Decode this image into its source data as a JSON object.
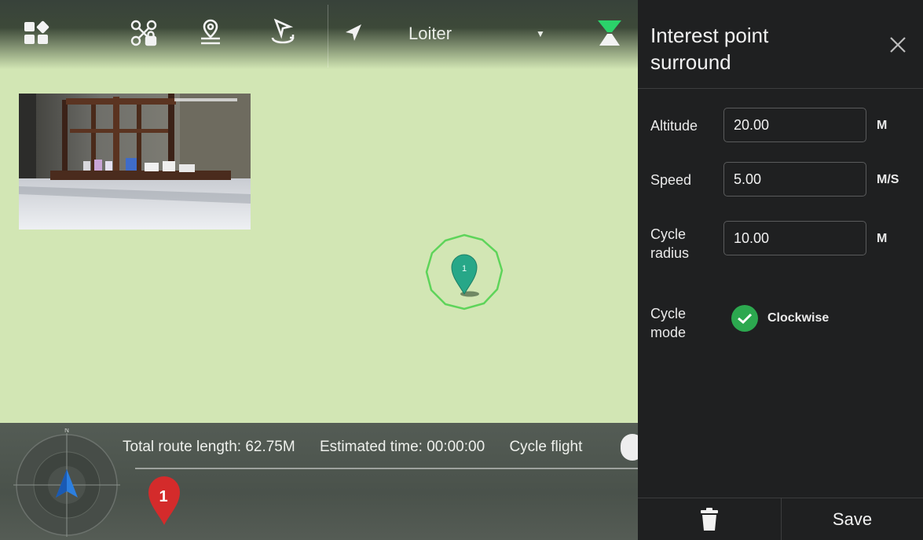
{
  "toolbar": {
    "icons": [
      "grid-menu-icon",
      "drone-lock-icon",
      "location-pin-icon",
      "surround-icon",
      "navigation-arrow-icon",
      "signal-icon"
    ],
    "mode": "Loiter"
  },
  "map": {
    "marker_label": "1",
    "waypoint_label": "1",
    "compass_label": "N"
  },
  "bottom": {
    "total_route_length": "Total route length: 62.75M",
    "estimated_time": "Estimated time: 00:00:00",
    "cycle_flight": "Cycle flight"
  },
  "panel": {
    "title": "Interest point surround",
    "fields": [
      {
        "label": "Altitude",
        "value": "20.00",
        "unit": "M"
      },
      {
        "label": "Speed",
        "value": "5.00",
        "unit": "M/S"
      },
      {
        "label": "Cycle radius",
        "value": "10.00",
        "unit": "M"
      }
    ],
    "cycle_mode_label": "Cycle mode",
    "cycle_mode_option": "Clockwise",
    "save_label": "Save"
  },
  "colors": {
    "map_bg": "#d2e6b4",
    "accent_green": "#2ca84f",
    "marker_teal": "#27a788",
    "waypoint_red": "#d42b2b",
    "panel_bg": "#1f2021"
  }
}
